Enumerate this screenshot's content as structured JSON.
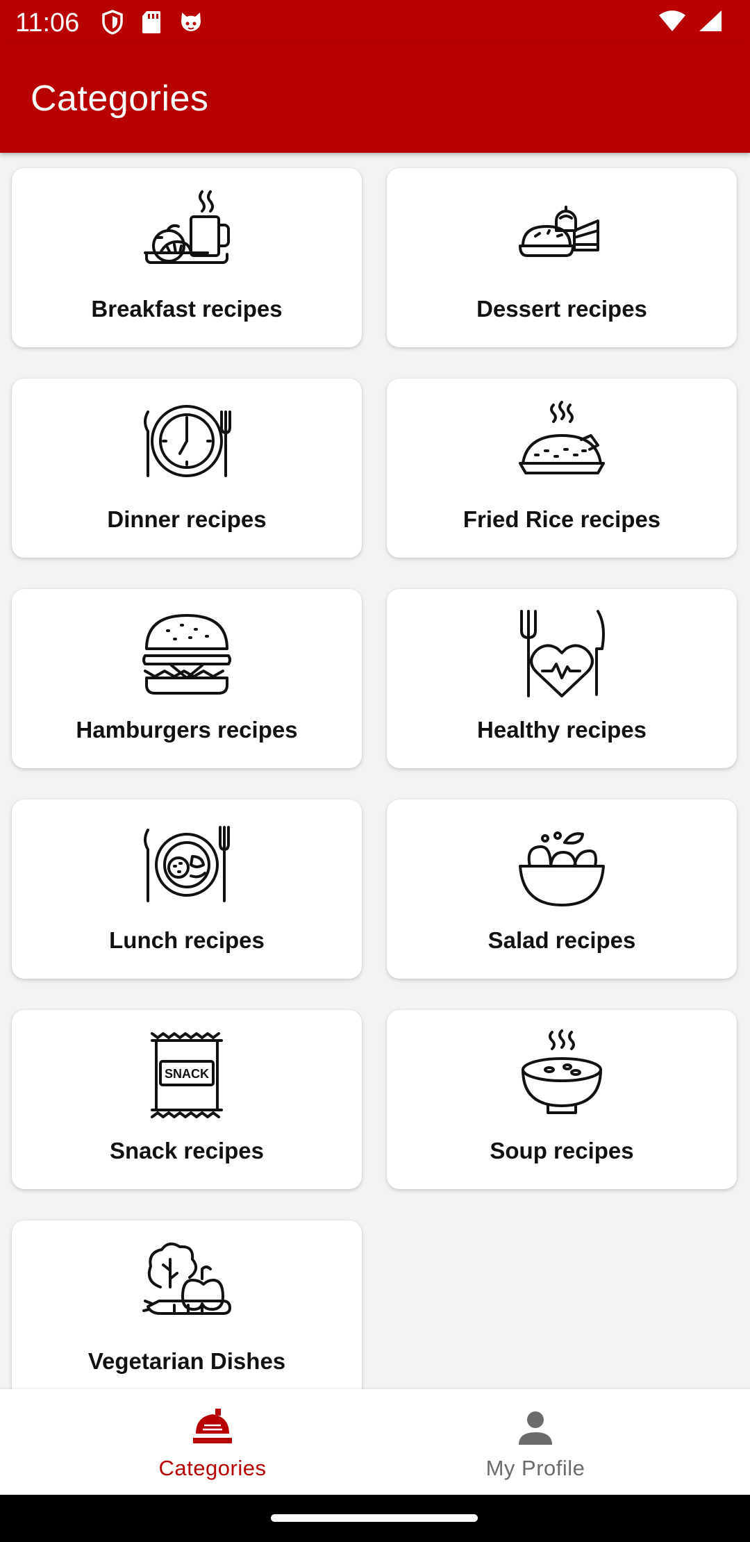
{
  "status": {
    "time": "11:06",
    "left_icons": [
      "shield-icon",
      "sd-card-icon",
      "cat-icon"
    ],
    "right_icons": [
      "wifi-icon",
      "signal-icon"
    ]
  },
  "appbar": {
    "title": "Categories"
  },
  "categories": [
    {
      "label": "Breakfast recipes",
      "icon": "breakfast-icon"
    },
    {
      "label": "Dessert recipes",
      "icon": "dessert-icon"
    },
    {
      "label": "Dinner recipes",
      "icon": "dinner-clock-icon"
    },
    {
      "label": "Fried Rice recipes",
      "icon": "fried-rice-icon"
    },
    {
      "label": "Hamburgers recipes",
      "icon": "hamburger-icon"
    },
    {
      "label": "Healthy recipes",
      "icon": "healthy-heart-icon"
    },
    {
      "label": "Lunch recipes",
      "icon": "lunch-plate-icon"
    },
    {
      "label": "Salad recipes",
      "icon": "salad-bowl-icon"
    },
    {
      "label": "Snack recipes",
      "icon": "snack-bag-icon",
      "icon_text": "SNACK"
    },
    {
      "label": "Soup recipes",
      "icon": "soup-bowl-icon"
    },
    {
      "label": "Vegetarian Dishes",
      "icon": "vegetables-icon"
    }
  ],
  "bottom_nav": {
    "items": [
      {
        "label": "Categories",
        "icon": "categories-icon",
        "active": true
      },
      {
        "label": "My Profile",
        "icon": "profile-icon",
        "active": false
      }
    ],
    "active_color": "#b80000",
    "inactive_color": "#6b6b6b"
  },
  "colors": {
    "primary": "#b80000",
    "background": "#f3f3f3",
    "card": "#ffffff"
  }
}
